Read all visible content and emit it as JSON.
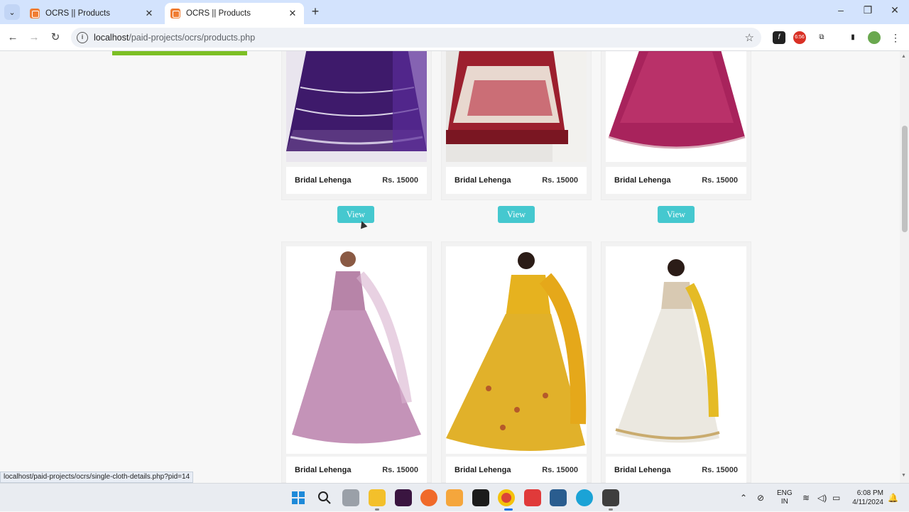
{
  "browser": {
    "tabs": [
      {
        "title": "OCRS || Products"
      },
      {
        "title": "OCRS || Products"
      }
    ],
    "url_host": "localhost",
    "url_path": "/paid-projects/ocrs/products.php",
    "status_url": "localhost/paid-projects/ocrs/single-cloth-details.php?pid=14",
    "extension_badge": "6:56"
  },
  "products_row1": [
    {
      "name": "Bridal Lehenga",
      "price": "Rs. 15000",
      "button": "View"
    },
    {
      "name": "Bridal Lehenga",
      "price": "Rs. 15000",
      "button": "View"
    },
    {
      "name": "Bridal Lehenga",
      "price": "Rs. 15000",
      "button": "View"
    }
  ],
  "products_row2": [
    {
      "name": "Bridal Lehenga",
      "price": "Rs. 15000"
    },
    {
      "name": "Bridal Lehenga",
      "price": "Rs. 15000"
    },
    {
      "name": "Bridal Lehenga",
      "price": "Rs. 15000"
    }
  ],
  "taskbar": {
    "lang_line1": "ENG",
    "lang_line2": "IN",
    "time": "6:08 PM",
    "date": "4/11/2024"
  },
  "colors": {
    "view_button": "#45c8cf",
    "accent_bar": "#7cbf24",
    "tabbar": "#d3e3fd"
  }
}
